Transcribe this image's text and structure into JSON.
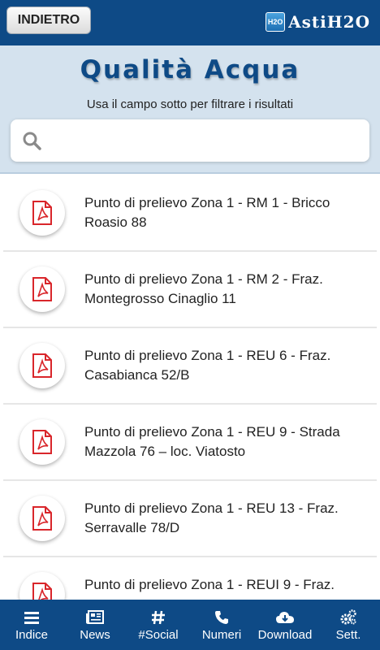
{
  "topbar": {
    "back_label": "INDIETRO",
    "brand_badge": "H2O",
    "brand_name": "AstiH2O"
  },
  "header": {
    "title": "Qualità Acqua",
    "subtitle": "Usa il campo sotto per filtrare i risultati"
  },
  "search": {
    "placeholder": "",
    "value": ""
  },
  "items": [
    {
      "label": "Punto di prelievo Zona 1 - RM 1 - Bricco Roasio 88"
    },
    {
      "label": "Punto di prelievo Zona 1 - RM 2 - Fraz. Montegrosso Cinaglio 11"
    },
    {
      "label": "Punto di prelievo Zona 1 - REU 6 - Fraz. Casabianca 52/B"
    },
    {
      "label": "Punto di prelievo Zona 1 - REU 9 - Strada Mazzola 76 – loc. Viatosto"
    },
    {
      "label": "Punto di prelievo Zona 1 - REU 13 - Fraz. Serravalle 78/D"
    },
    {
      "label": "Punto di prelievo Zona 1 - REUI 9 - Fraz."
    }
  ],
  "nav": [
    {
      "label": "Indice",
      "icon": "menu-icon"
    },
    {
      "label": "News",
      "icon": "newspaper-icon"
    },
    {
      "label": "#Social",
      "icon": "hashtag-icon"
    },
    {
      "label": "Numeri",
      "icon": "phone-icon"
    },
    {
      "label": "Download",
      "icon": "cloud-download-icon"
    },
    {
      "label": "Sett.",
      "icon": "gears-icon"
    }
  ],
  "colors": {
    "primary": "#0e4a86",
    "header_bg": "#d4e2ee",
    "pdf_red": "#d9262b"
  }
}
